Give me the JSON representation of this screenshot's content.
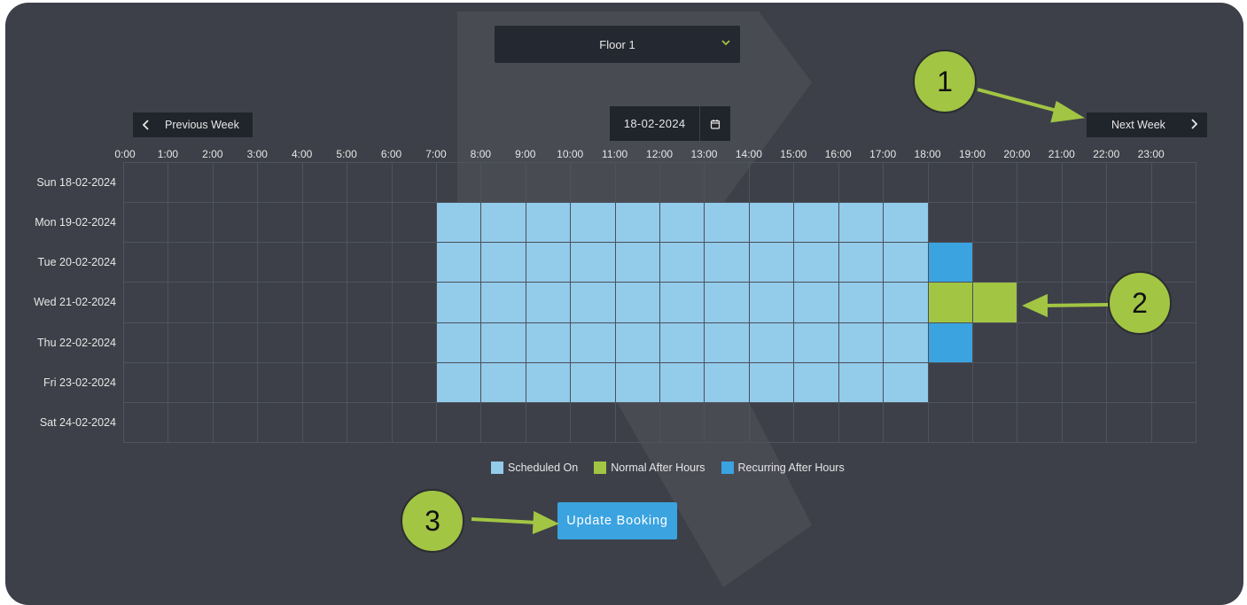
{
  "floor_select": {
    "value": "Floor 1"
  },
  "nav": {
    "prev_label": "Previous Week",
    "next_label": "Next Week"
  },
  "date_picker": {
    "value": "18-02-2024"
  },
  "hours": [
    "0:00",
    "1:00",
    "2:00",
    "3:00",
    "4:00",
    "5:00",
    "6:00",
    "7:00",
    "8:00",
    "9:00",
    "10:00",
    "11:00",
    "12:00",
    "13:00",
    "14:00",
    "15:00",
    "16:00",
    "17:00",
    "18:00",
    "19:00",
    "20:00",
    "21:00",
    "22:00",
    "23:00"
  ],
  "days": [
    {
      "label": "Sun 18-02-2024",
      "cells": []
    },
    {
      "label": "Mon 19-02-2024",
      "cells": [
        {
          "from": 7,
          "to": 18,
          "type": "scheduled"
        }
      ]
    },
    {
      "label": "Tue 20-02-2024",
      "cells": [
        {
          "from": 7,
          "to": 18,
          "type": "scheduled"
        },
        {
          "from": 18,
          "to": 19,
          "type": "recurring"
        }
      ]
    },
    {
      "label": "Wed 21-02-2024",
      "cells": [
        {
          "from": 7,
          "to": 18,
          "type": "scheduled"
        },
        {
          "from": 18,
          "to": 20,
          "type": "normal"
        }
      ]
    },
    {
      "label": "Thu 22-02-2024",
      "cells": [
        {
          "from": 7,
          "to": 18,
          "type": "scheduled"
        },
        {
          "from": 18,
          "to": 19,
          "type": "recurring"
        }
      ]
    },
    {
      "label": "Fri 23-02-2024",
      "cells": [
        {
          "from": 7,
          "to": 18,
          "type": "scheduled"
        }
      ]
    },
    {
      "label": "Sat 24-02-2024",
      "cells": []
    }
  ],
  "legend": [
    {
      "label": "Scheduled On",
      "color": "#93cbeb"
    },
    {
      "label": "Normal After Hours",
      "color": "#a2c544"
    },
    {
      "label": "Recurring After Hours",
      "color": "#3aa3e0"
    }
  ],
  "update_button": {
    "label": "Update Booking"
  },
  "callouts": [
    "1",
    "2",
    "3"
  ],
  "colors": {
    "background": "#3d4048",
    "accent": "#3aa3e0",
    "callout": "#a2c544"
  }
}
